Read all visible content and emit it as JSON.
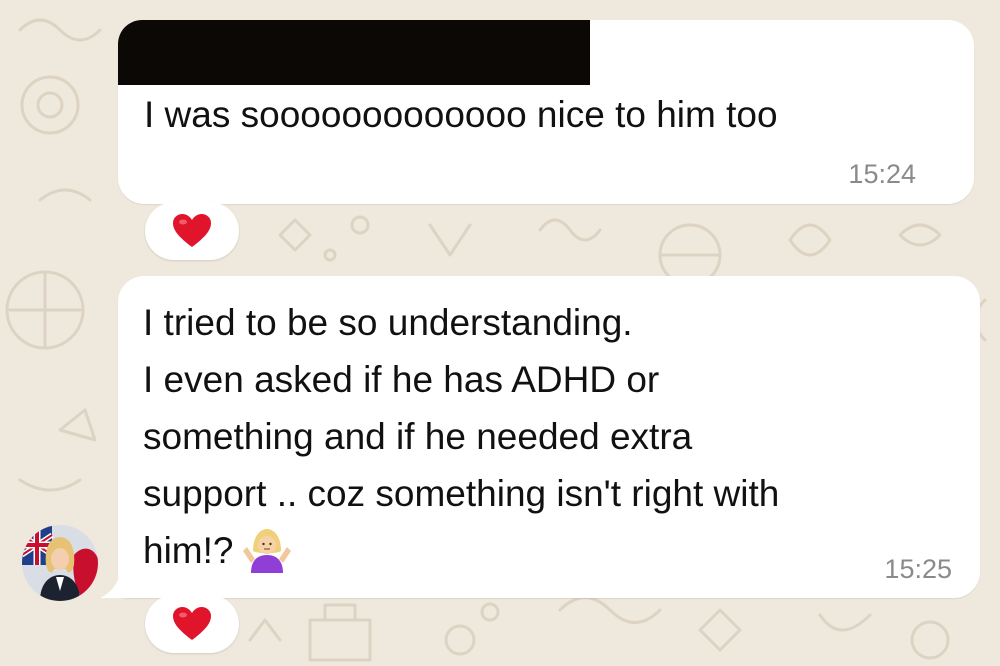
{
  "chat": {
    "messages": [
      {
        "text": "I was sooooooooooooo nice to him too",
        "time": "15:24",
        "reaction": "heart-emoji",
        "sender_name_redacted": true
      },
      {
        "lines": [
          "I tried to be so understanding.",
          "I even asked if he has ADHD or",
          "something and if he needed extra",
          "support .. coz something isn't right with",
          "him!?"
        ],
        "emoji": "woman-shrugging-emoji",
        "time": "15:25",
        "reaction": "heart-emoji"
      }
    ]
  },
  "colors": {
    "wallpaper": "#efe8dc",
    "bubble": "#ffffff",
    "timestamp": "#8a8a8a",
    "heart": "#e0142b"
  }
}
